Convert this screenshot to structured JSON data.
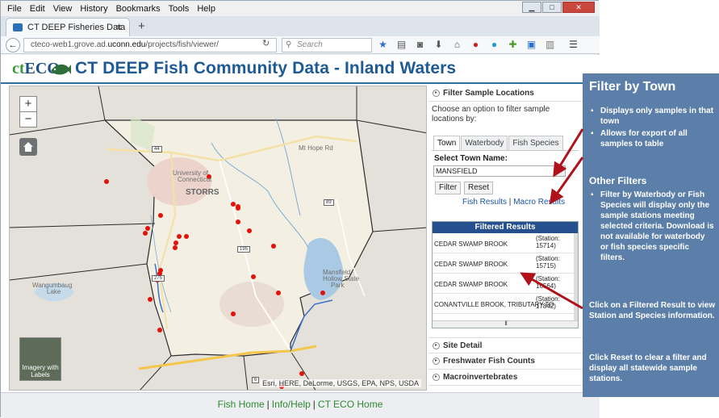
{
  "browser": {
    "menu": [
      "File",
      "Edit",
      "View",
      "History",
      "Bookmarks",
      "Tools",
      "Help"
    ],
    "tab_title": "CT DEEP Fisheries Data",
    "url_prefix": "cteco-web1.grove.ad.",
    "url_domain": "uconn.edu",
    "url_path": "/projects/fish/viewer/",
    "search_placeholder": "Search"
  },
  "header": {
    "logo": "ECO",
    "logo_prefix": "ct",
    "title": "CT DEEP Fish Community Data - Inland Waters"
  },
  "map": {
    "zoom_in": "+",
    "zoom_out": "−",
    "imagery_label": "Imagery with Labels",
    "attribution": "Esri, HERE, DeLorme, USGS, EPA, NPS, USDA",
    "labels": {
      "univ": "University of",
      "conn": "Connecticut",
      "storrs": "STORRS",
      "mansfield": "Mansfield",
      "hollow": "Hollow State",
      "park": "Park",
      "wango": "Wangumbaug",
      "lake": "Lake",
      "mthope": "Mt Hope Rd"
    },
    "shields": [
      "44",
      "89",
      "195",
      "275",
      "6"
    ]
  },
  "panel": {
    "filter_header": "Filter Sample Locations",
    "prompt": "Choose an option to filter sample locations by:",
    "tabs": [
      "Town",
      "Waterbody",
      "Fish Species"
    ],
    "select_label": "Select Town Name:",
    "selected_town": "MANSFIELD",
    "filter_button": "Filter",
    "reset_button": "Reset",
    "fish_results": "Fish Results",
    "macro_results": "Macro Results",
    "link_sep": "|",
    "results_header": "Filtered Results",
    "results": [
      {
        "name": "CEDAR SWAMP BROOK",
        "station": "(Station: 15714)"
      },
      {
        "name": "CEDAR SWAMP BROOK",
        "station": "(Station: 15715)"
      },
      {
        "name": "CEDAR SWAMP BROOK",
        "station": "(Station: 16564)"
      },
      {
        "name": "CONANTVILLE BROOK, TRIBUTARY TO",
        "station": "(Station: 17842)"
      }
    ],
    "site_detail": "Site Detail",
    "fish_counts": "Freshwater Fish Counts",
    "macro": "Macroinvertebrates"
  },
  "footer": {
    "home": "Fish Home",
    "help": "Info/Help",
    "eco": "CT ECO Home",
    "sep": "|"
  },
  "callout": {
    "title": "Filter by Town",
    "town_bullets": [
      "Displays only samples in that town",
      "Allows for export of all samples to table"
    ],
    "other_title": "Other Filters",
    "other_bullets": [
      "Filter by Waterbody or Fish Species will display only the sample stations meeting selected criteria. Download is not available for waterbody or fish species specific filters."
    ],
    "click_note": "Click on a Filtered Result to view Station and Species information.",
    "reset_note": "Click Reset to clear a filter and display all statewide sample stations."
  }
}
